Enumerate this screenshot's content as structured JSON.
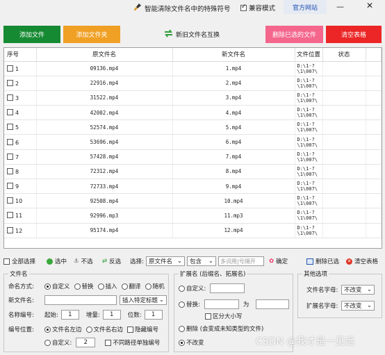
{
  "titlebar": {
    "title": "智能清除文件名中的特殊符号",
    "compat_label": "兼容模式",
    "compat_checked": true,
    "website_label": "官方网站",
    "minimize": "—",
    "close": "✕"
  },
  "actions": {
    "add_file": "添加文件",
    "add_folder": "添加文件夹",
    "swap": "新旧文件名互换",
    "delete_selected": "删除已选的文件",
    "clear_table": "清空表格"
  },
  "colors": {
    "add_file": "#168a32",
    "add_folder": "#f0a024",
    "delete_selected": "#f4668c",
    "clear_table": "#ec2626"
  },
  "table": {
    "headers": [
      "序号",
      "原文件名",
      "新文件名",
      "文件位置",
      "状态"
    ],
    "rows": [
      {
        "no": "1",
        "orig": "09136.mp4",
        "new": "1.mp4",
        "loc1": "D:\\1-?",
        "loc2": "\\1\\007\\",
        "status": ""
      },
      {
        "no": "2",
        "orig": "22916.mp4",
        "new": "2.mp4",
        "loc1": "D:\\1-?",
        "loc2": "\\1\\007\\",
        "status": ""
      },
      {
        "no": "3",
        "orig": "31522.mp4",
        "new": "3.mp4",
        "loc1": "D:\\1-?",
        "loc2": "\\1\\007\\",
        "status": ""
      },
      {
        "no": "4",
        "orig": "42002.mp4",
        "new": "4.mp4",
        "loc1": "D:\\1-?",
        "loc2": "\\1\\007\\",
        "status": ""
      },
      {
        "no": "5",
        "orig": "52574.mp4",
        "new": "5.mp4",
        "loc1": "D:\\1-?",
        "loc2": "\\1\\007\\",
        "status": ""
      },
      {
        "no": "6",
        "orig": "53696.mp4",
        "new": "6.mp4",
        "loc1": "D:\\1-?",
        "loc2": "\\1\\007\\",
        "status": ""
      },
      {
        "no": "7",
        "orig": "57428.mp4",
        "new": "7.mp4",
        "loc1": "D:\\1-?",
        "loc2": "\\1\\007\\",
        "status": ""
      },
      {
        "no": "8",
        "orig": "72312.mp4",
        "new": "8.mp4",
        "loc1": "D:\\1-?",
        "loc2": "\\1\\007\\",
        "status": ""
      },
      {
        "no": "9",
        "orig": "72733.mp4",
        "new": "9.mp4",
        "loc1": "D:\\1-?",
        "loc2": "\\1\\007\\",
        "status": ""
      },
      {
        "no": "10",
        "orig": "92508.mp4",
        "new": "10.mp4",
        "loc1": "D:\\1-?",
        "loc2": "\\1\\007\\",
        "status": ""
      },
      {
        "no": "11",
        "orig": "92996.mp3",
        "new": "11.mp3",
        "loc1": "D:\\1-?",
        "loc2": "\\1\\007\\",
        "status": ""
      },
      {
        "no": "12",
        "orig": "95174.mp4",
        "new": "12.mp4",
        "loc1": "D:\\1-?",
        "loc2": "\\1\\007\\",
        "status": ""
      }
    ]
  },
  "toolbar": {
    "select_all": "全部选择",
    "select": "选中",
    "deselect": "不选",
    "invert": "反选",
    "choose_label": "选择:",
    "field_value": "原文件名",
    "match_value": "包含",
    "keyword_placeholder": "多词用|号隔开",
    "confirm": "确定",
    "delete_selected": "删除已选",
    "clear_table": "清空表格"
  },
  "filename": {
    "title": "文件名",
    "naming_label": "命名方式:",
    "naming_options": [
      "自定义",
      "替换",
      "插入",
      "翻译",
      "随机"
    ],
    "new_name_label": "新文件名:",
    "insert_label": "插入特定标题",
    "numbering_label": "名称编号:",
    "start_label": "起始:",
    "start_value": "1",
    "increment_label": "增量:",
    "increment_value": "1",
    "digits_label": "位数:",
    "digits_value": "1",
    "position_label": "编号位置:",
    "position_options": [
      "文件名左边",
      "文件名右边"
    ],
    "hide_number": "隐藏编号",
    "custom_label": "自定义:",
    "custom_value": "2",
    "no_single_path": "不同路径单独编号"
  },
  "extension": {
    "title": "扩展名 (后缀名、拓展名)",
    "custom": "自定义:",
    "replace": "替换:",
    "as_label": "为",
    "case_sensitive": "区分大小写",
    "delete": "删除 (会变成未知类型的文件)",
    "no_change": "不改变"
  },
  "other": {
    "title": "其他选项",
    "name_case_label": "文件名字母:",
    "name_case_value": "不改变",
    "ext_case_label": "扩展名字母:",
    "ext_case_value": "不改变"
  },
  "watermark": "CSDN @我才是一见远"
}
